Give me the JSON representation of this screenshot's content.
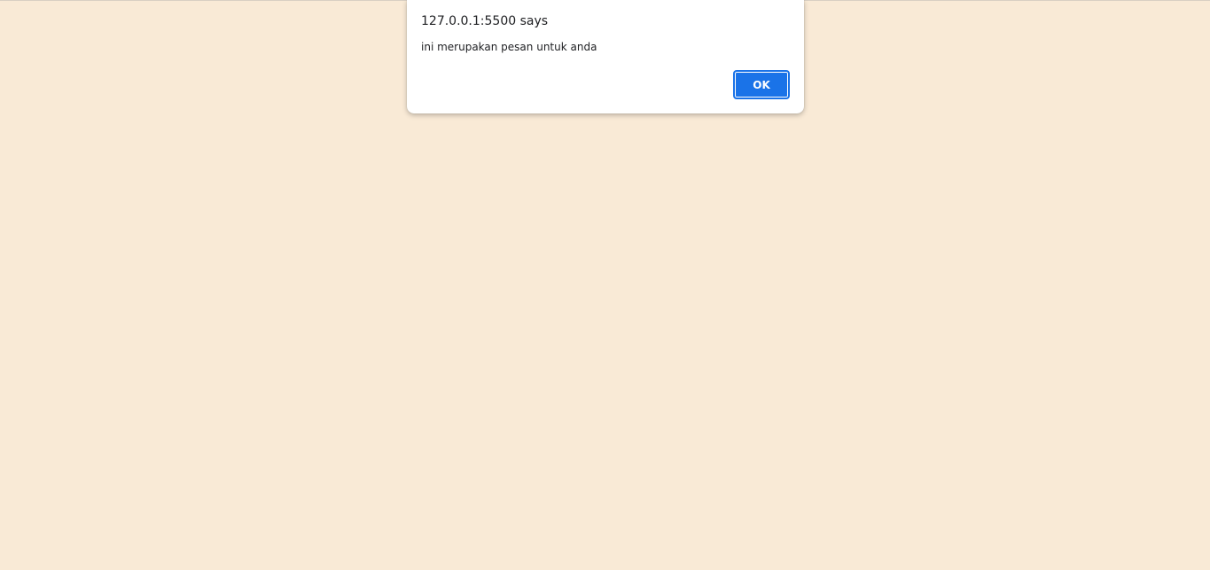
{
  "page": {
    "background_color": "#f9ead6"
  },
  "dialog": {
    "title": "127.0.0.1:5500 says",
    "message": "ini merupakan pesan untuk anda",
    "ok_label": "OK",
    "accent_color": "#1a73e8"
  }
}
